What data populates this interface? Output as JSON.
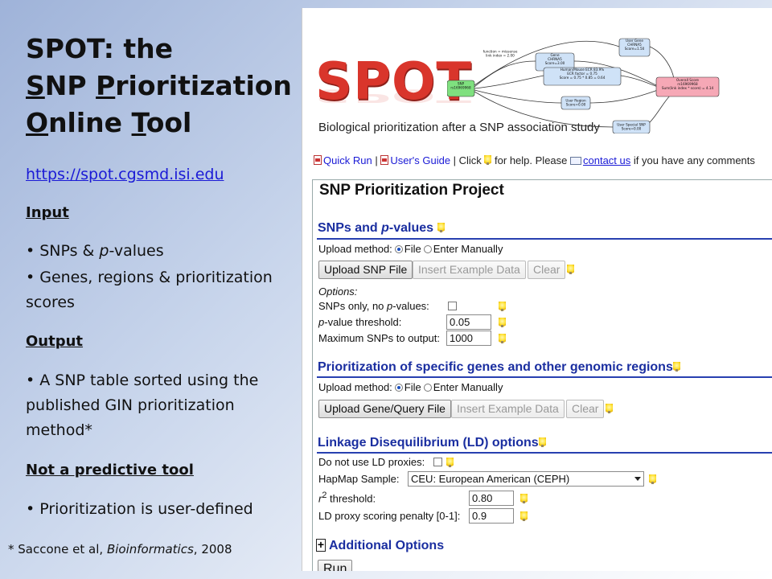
{
  "slide": {
    "title_line1": "SPOT: the",
    "title_line2_parts": [
      "S",
      "NP ",
      "P",
      "rioritization"
    ],
    "title_line3_parts": [
      "O",
      "nline ",
      "T",
      "ool"
    ],
    "url": "https://spot.cgsmd.isi.edu",
    "input_heading": "Input",
    "input_items": [
      "SNPs & ",
      "p",
      "-values"
    ],
    "input_item2": "Genes, regions & prioritization scores",
    "output_heading": "Output",
    "output_item": "A SNP table sorted using the published GIN prioritization method*",
    "not_predictive_heading": "Not a predictive tool",
    "not_predictive_item": "Prioritization is user-defined",
    "footnote_prefix": "* Saccone et al, ",
    "footnote_journal": "Bioinformatics",
    "footnote_suffix": ", 2008",
    "bullet": "•"
  },
  "app": {
    "logo": "SPOT",
    "tagline": "Biological prioritization after a SNP association study",
    "diagram": {
      "snp_node": "SNP\nrs16969968",
      "function_label": "function = missense\nlink index = 2.00",
      "gene_node": "Gene\nCHRNA5\nScore=3.00",
      "ecr_node": "Human/Mouse ECR 83.9%\nECR factor = 0.75\nScore = 0.75 * 0.85 = 0.64",
      "region_node": "User Region\nScore=0.00",
      "user_gene_node": "User Gene\nCHRNA5\nScore=1.50",
      "special_snp_node": "User Special SNP\nScore=0.00",
      "overall_node": "Overall Score\nrs16969968\nSum(link index * score) = 4.14"
    },
    "helpbar": {
      "quick_run": "Quick Run",
      "sep1": " | ",
      "users_guide": "User's Guide",
      "click": " | Click ",
      "for_help": " for help. Please ",
      "contact_us": "contact us",
      "if_you_have": " if you have any comments"
    },
    "project_title": "SNP Prioritization Project",
    "snps_section": {
      "heading_prefix": "SNPs and ",
      "heading_p": "p",
      "heading_suffix": "-values",
      "upload_method_label": "Upload method:",
      "radio_file": "File",
      "radio_manual": "Enter Manually",
      "upload_button": "Upload SNP File",
      "example_button": "Insert Example Data",
      "clear_button": "Clear",
      "options_label": "Options:",
      "snps_only_label_prefix": "SNPs only, no ",
      "snps_only_label_p": "p",
      "snps_only_label_suffix": "-values:",
      "threshold_label_p": "p",
      "threshold_label_suffix": "-value threshold:",
      "threshold_value": "0.05",
      "max_snps_label": "Maximum SNPs to output:",
      "max_snps_value": "1000"
    },
    "genes_section": {
      "heading": "Prioritization of specific genes and other genomic regions",
      "upload_method_label": "Upload method:",
      "radio_file": "File",
      "radio_manual": "Enter Manually",
      "upload_button": "Upload Gene/Query File",
      "example_button": "Insert Example Data",
      "clear_button": "Clear"
    },
    "ld_section": {
      "heading": "Linkage Disequilibrium (LD) options",
      "no_ld_label": "Do not use LD proxies:",
      "hapmap_label": "HapMap Sample:",
      "hapmap_value": "CEU: European American (CEPH)",
      "r2_label_r": "r",
      "r2_label_sup": "2",
      "r2_label_suffix": " threshold:",
      "r2_value": "0.80",
      "penalty_label": "LD proxy scoring penalty [0-1]:",
      "penalty_value": "0.9"
    },
    "additional_options": "Additional Options",
    "run_button": "Run"
  },
  "colors": {
    "logo_red": "#d9352b",
    "section_blue": "#1a2ea0",
    "link_blue": "#1a1ad6",
    "node_green": "#7fe07f",
    "node_blue": "#cfe2f7",
    "node_pink": "#f6a8b6"
  }
}
